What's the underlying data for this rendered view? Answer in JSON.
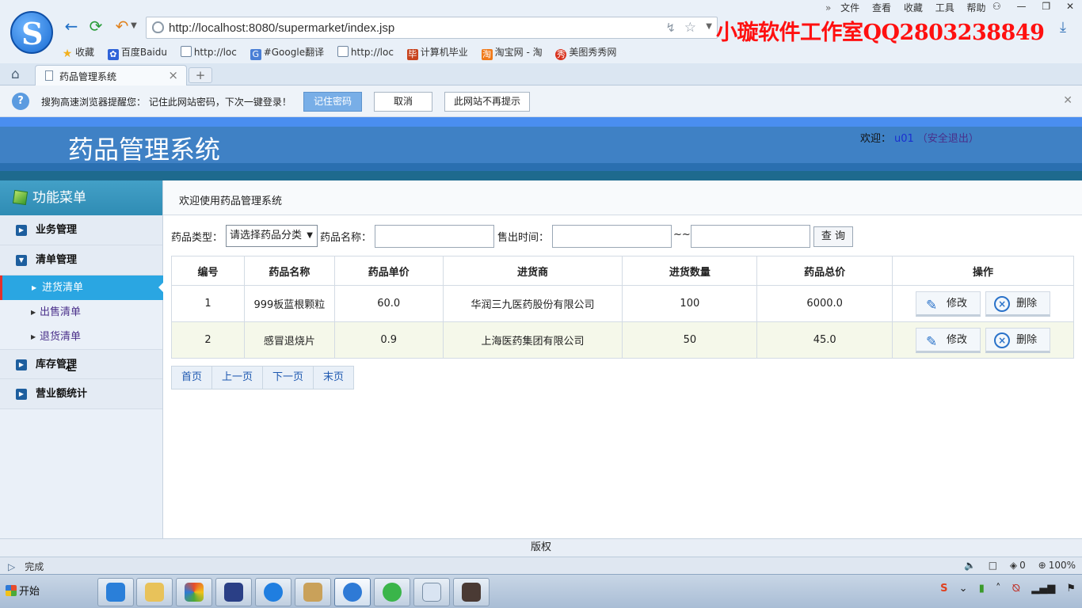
{
  "browser": {
    "address": "http://localhost:8080/supermarket/index.jsp",
    "menu": [
      "文件",
      "查看",
      "收藏",
      "工具",
      "帮助"
    ],
    "bookmarks": [
      {
        "label": "收藏",
        "icon": "star-icon"
      },
      {
        "label": "百度Baidu",
        "icon": "baidu-icon"
      },
      {
        "label": "http://loc",
        "icon": "page-icon"
      },
      {
        "label": "#Google翻译",
        "icon": "google-translate-icon"
      },
      {
        "label": "http://loc",
        "icon": "page-icon"
      },
      {
        "label": "计算机毕业",
        "icon": "bookmark-icon"
      },
      {
        "label": "淘宝网 - 淘",
        "icon": "taobao-icon"
      },
      {
        "label": "美图秀秀网",
        "icon": "meitu-icon"
      }
    ],
    "tab_title": "药品管理系统",
    "tab_new": "+",
    "watermark": "小璇软件工作室QQ2803238849",
    "notify": {
      "text": "搜狗高速浏览器提醒您： 记住此网站密码，下次一键登录！",
      "remember": "记住密码",
      "cancel": "取消",
      "never": "此网站不再提示"
    },
    "status_left": "完成",
    "status_zoom": "100%",
    "status_count": "0"
  },
  "app": {
    "title": "药品管理系统",
    "welcome_prefix": "欢迎：",
    "username": "u01",
    "logout_open": "（",
    "logout": "安全退出",
    "logout_close": "）",
    "menu_title": "功能菜单",
    "menu": {
      "g1": "业务管理",
      "g2": "清单管理",
      "g2_items": [
        "进货清单",
        "出售清单",
        "退货清单"
      ],
      "g3": "库存管理",
      "g4": "营业额统计"
    },
    "breadcrumb": "欢迎使用药品管理系统",
    "search": {
      "type_label": "药品类型：",
      "type_value": "请选择药品分类",
      "name_label": "药品名称：",
      "time_label": "售出时间：",
      "tilde": "~~",
      "query": "查 询"
    },
    "table": {
      "headers": [
        "编号",
        "药品名称",
        "药品单价",
        "进货商",
        "进货数量",
        "药品总价",
        "操作"
      ],
      "rows": [
        [
          "1",
          "999板蓝根颗粒",
          "60.0",
          "华润三九医药股份有限公司",
          "100",
          "6000.0"
        ],
        [
          "2",
          "感冒退烧片",
          "0.9",
          "上海医药集团有限公司",
          "50",
          "45.0"
        ]
      ],
      "edit": "修改",
      "delete": "删除"
    },
    "pager": [
      "首页",
      "上一页",
      "下一页",
      "末页"
    ],
    "footer": "版权"
  },
  "taskbar": {
    "start": "开始"
  }
}
